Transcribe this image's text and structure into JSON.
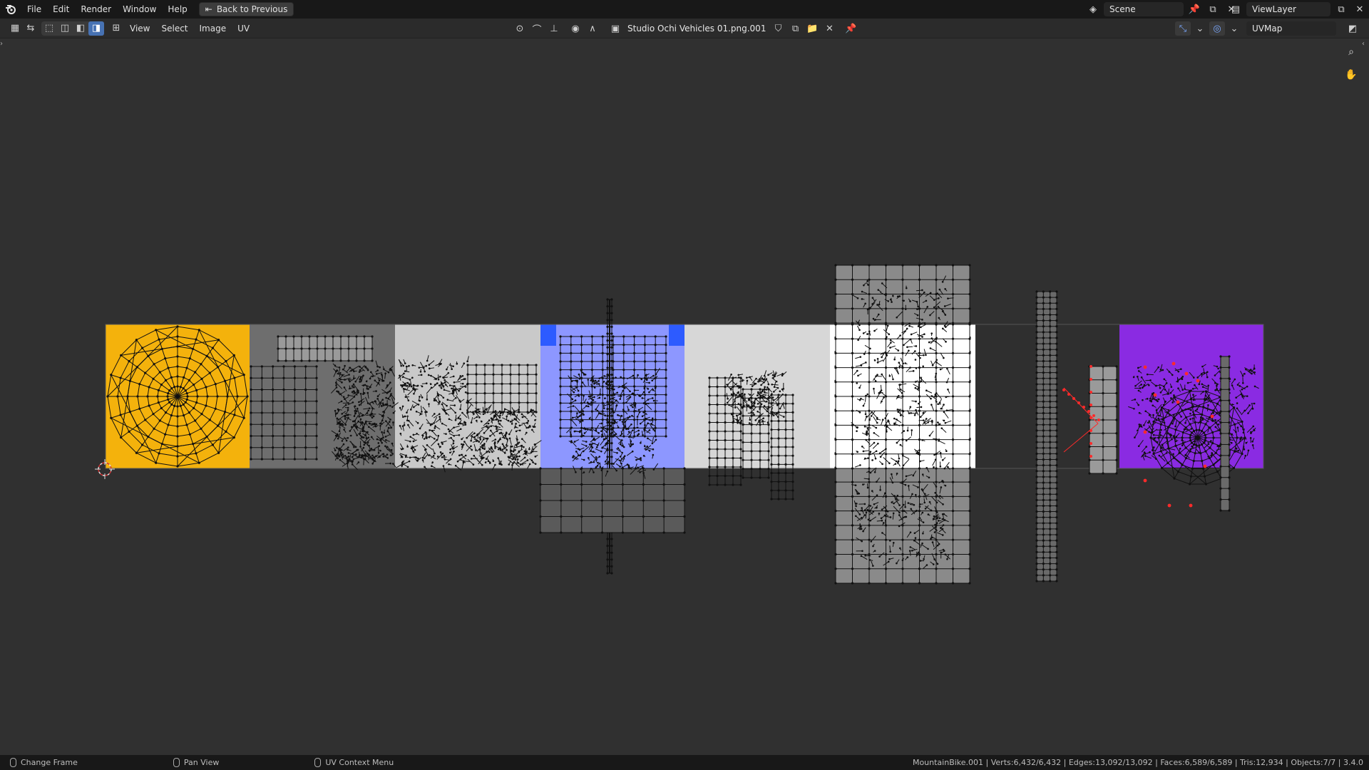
{
  "topbar": {
    "logo_icon": "blender-logo-icon",
    "menus": [
      "File",
      "Edit",
      "Render",
      "Window",
      "Help"
    ],
    "back_button": "Back to Previous",
    "scene_name": "Scene",
    "view_layer": "ViewLayer"
  },
  "editor_header": {
    "menus": [
      "View",
      "Select",
      "Image",
      "UV"
    ],
    "image_name": "Studio Ochi Vehicles 01.png.001",
    "uv_map": "UVMap"
  },
  "atlas_colors": {
    "tile1": "#f4b20c",
    "tile2": "#6e6e6e",
    "tile3": "#c9c9c9",
    "tile4": "#8d97ff",
    "tile5": "#d7d7d7",
    "tile6": "#ffffff",
    "tile7": "#2f2f2f",
    "tile8": "#8a2be2",
    "wire": "#111111",
    "selected_vertex": "#ff2a2a"
  },
  "statusbar": {
    "left_actions": [
      "Change Frame",
      "Pan View",
      "UV Context Menu"
    ],
    "stats": "MountainBike.001 | Verts:6,432/6,432 | Edges:13,092/13,092 | Faces:6,589/6,589 | Tris:12,934 | Objects:7/7 | 3.4.0"
  }
}
